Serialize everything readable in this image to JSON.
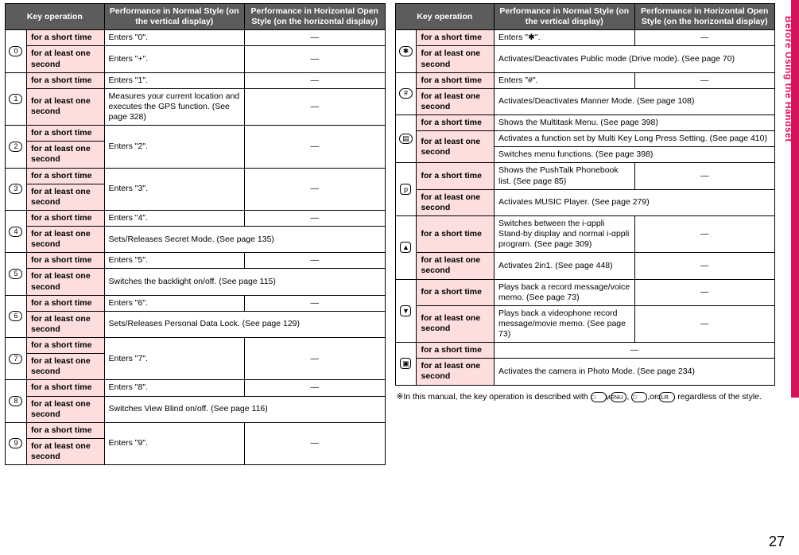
{
  "sideTab": "Before Using the Handset",
  "pageNumber": "27",
  "headers": {
    "key": "Key operation",
    "vert": "Performance in Normal Style (on the vertical display)",
    "horiz": "Performance in Horizontal Open Style (on the horizontal display)"
  },
  "dur": {
    "short": "for a short time",
    "long": "for at least one second"
  },
  "dash": "—",
  "left": [
    {
      "icon": "0",
      "short": {
        "v": "Enters \"0\".",
        "h": "—"
      },
      "long": {
        "v": "Enters \"+\".",
        "h": "—"
      }
    },
    {
      "icon": "1",
      "short": {
        "v": "Enters \"1\".",
        "h": "—"
      },
      "long": {
        "v": "Measures your current location and executes the GPS function. (See page 328)",
        "h": "—"
      }
    },
    {
      "icon": "2",
      "merged": true,
      "v": "Enters \"2\".",
      "h": "—"
    },
    {
      "icon": "3",
      "merged": true,
      "v": "Enters \"3\".",
      "h": "—"
    },
    {
      "icon": "4",
      "short": {
        "v": "Enters \"4\".",
        "h": "—"
      },
      "long": {
        "span": "Sets/Releases Secret Mode. (See page 135)"
      }
    },
    {
      "icon": "5",
      "short": {
        "v": "Enters \"5\".",
        "h": "—"
      },
      "long": {
        "span": "Switches the backlight on/off. (See page 115)"
      }
    },
    {
      "icon": "6",
      "short": {
        "v": "Enters \"6\".",
        "h": "—"
      },
      "long": {
        "span": "Sets/Releases Personal Data Lock. (See page 129)"
      }
    },
    {
      "icon": "7",
      "merged": true,
      "v": "Enters \"7\".",
      "h": "—"
    },
    {
      "icon": "8",
      "short": {
        "v": "Enters \"8\".",
        "h": "—"
      },
      "long": {
        "span": "Switches View Blind on/off. (See page 116)"
      }
    },
    {
      "icon": "9",
      "merged": true,
      "v": "Enters \"9\".",
      "h": "—"
    }
  ],
  "right": [
    {
      "icon": "✱",
      "short": {
        "v": "Enters \"✱\".",
        "h": "—"
      },
      "long": {
        "span": "Activates/Deactivates Public mode (Drive mode). (See page 70)"
      }
    },
    {
      "icon": "#",
      "short": {
        "v": "Enters \"#\".",
        "h": "—"
      },
      "long": {
        "span": "Activates/Deactivates Manner Mode. (See page 108)"
      }
    },
    {
      "icon": "multi",
      "short": {
        "span": "Shows the Multitask Menu. (See page 398)"
      },
      "long2": {
        "a": "Activates a function set by Multi Key Long Press Setting. (See page 410)",
        "b": "Switches menu functions. (See page 398)"
      }
    },
    {
      "icon": "p",
      "short": {
        "v": "Shows the PushTalk Phonebook list. (See page 85)",
        "h": "—"
      },
      "long": {
        "span": "Activates MUSIC Player. (See page 279)"
      }
    },
    {
      "icon": "up",
      "short": {
        "v": "Switches between the i-αppli Stand-by display and normal i-αppli program. (See page 309)",
        "h": "—"
      },
      "long": {
        "v": "Activates 2in1. (See page 448)",
        "h": "—"
      }
    },
    {
      "icon": "dn",
      "short": {
        "v": "Plays back a record message/voice memo. (See page 73)",
        "h": "—"
      },
      "long": {
        "v": "Plays back a videophone record message/movie memo. (See page 73)",
        "h": "—"
      }
    },
    {
      "icon": "cam",
      "short": {
        "spanH": "—"
      },
      "long": {
        "span": "Activates the camera in Photo Mode. (See page 234)"
      }
    }
  ],
  "noteSymbol": "※",
  "noteText": "In this manual, the key operation is described with",
  "noteKeys": [
    "□",
    "MENU",
    "□",
    "CLR"
  ],
  "noteSep": [
    ", ",
    ", ",
    ",or "
  ],
  "noteEnd": " regardless of the style."
}
